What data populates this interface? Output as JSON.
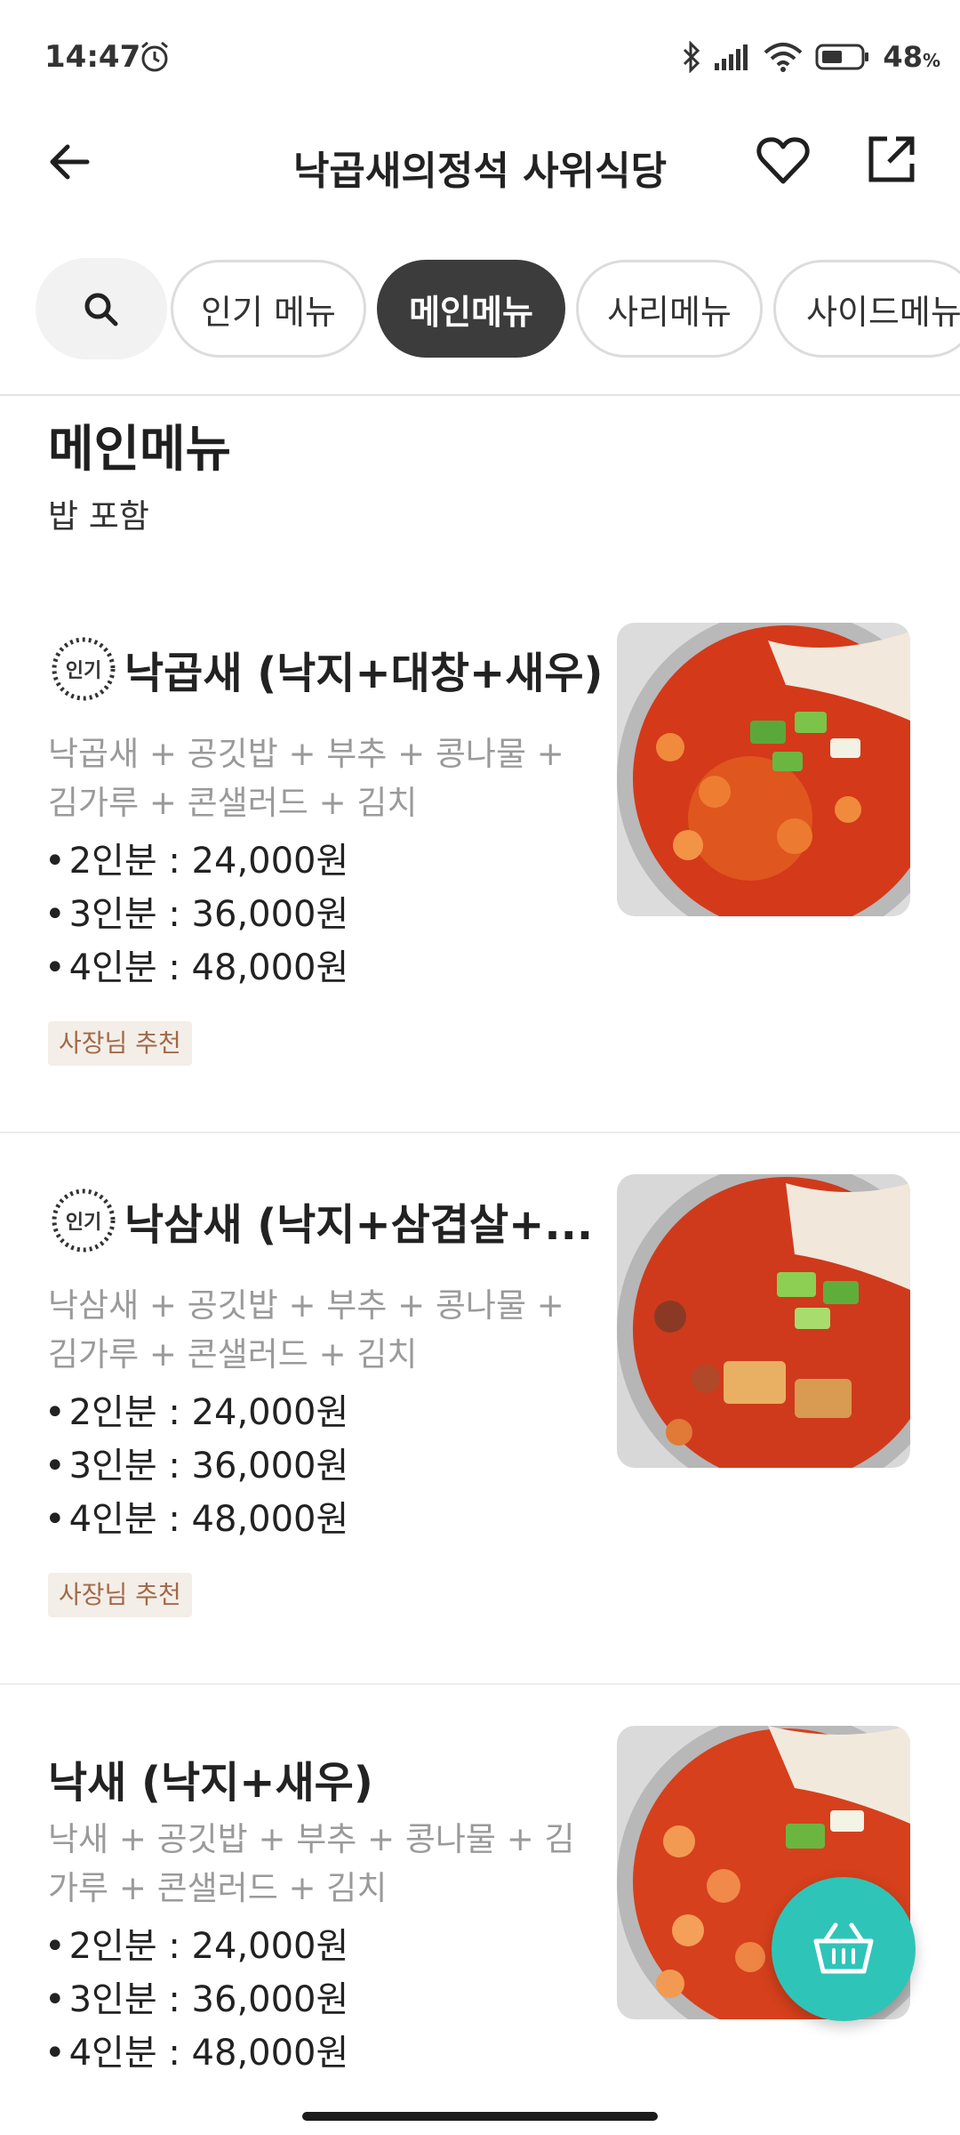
{
  "status_bar": {
    "time": "14:47",
    "battery": "48",
    "battery_unit": "%",
    "icons": [
      "alarm-icon",
      "bluetooth-icon",
      "signal-icon",
      "wifi-icon",
      "battery-icon"
    ]
  },
  "header": {
    "title": "낙곱새의정석 사위식당",
    "icons": [
      "back-arrow-icon",
      "heart-icon",
      "share-icon"
    ]
  },
  "categories": {
    "search_icon": "search-icon",
    "chips": [
      "인기 메뉴",
      "메인메뉴",
      "사리메뉴",
      "사이드메뉴"
    ],
    "active": "메인메뉴"
  },
  "section": {
    "title": "메인메뉴",
    "subtitle": "밥 포함"
  },
  "menu_items": [
    {
      "badge": "인기",
      "name": "낙곱새 (낙지+대창+새우)",
      "desc": "낙곱새 + 공깃밥 + 부추 + 콩나물 + 김가루 + 콘샐러드 + 김치",
      "prices": [
        "2인분 : 24,000원",
        "3인분 : 36,000원",
        "4인분 : 48,000원"
      ],
      "tag": "사장님 추천"
    },
    {
      "badge": "인기",
      "name": "낙삼새 (낙지+삼겹살+...",
      "desc": "낙삼새 + 공깃밥 + 부추 + 콩나물 + 김가루 + 콘샐러드 + 김치",
      "prices": [
        "2인분 : 24,000원",
        "3인분 : 36,000원",
        "4인분 : 48,000원"
      ],
      "tag": "사장님 추천"
    },
    {
      "name": "낙새 (낙지+새우)",
      "desc": "낙새 + 공깃밥 + 부추 + 콩나물 + 김가루 + 콘샐러드 + 김치",
      "prices": [
        "2인분 : 24,000원",
        "3인분 : 36,000원",
        "4인분 : 48,000원"
      ]
    }
  ],
  "cart": {
    "icon": "basket-icon"
  },
  "colors": {
    "accent": "#2fc4b8",
    "chip_active": "#3c3c3c",
    "recommend_tag_bg": "#f4eee8",
    "recommend_tag_text": "#a06a4a"
  }
}
